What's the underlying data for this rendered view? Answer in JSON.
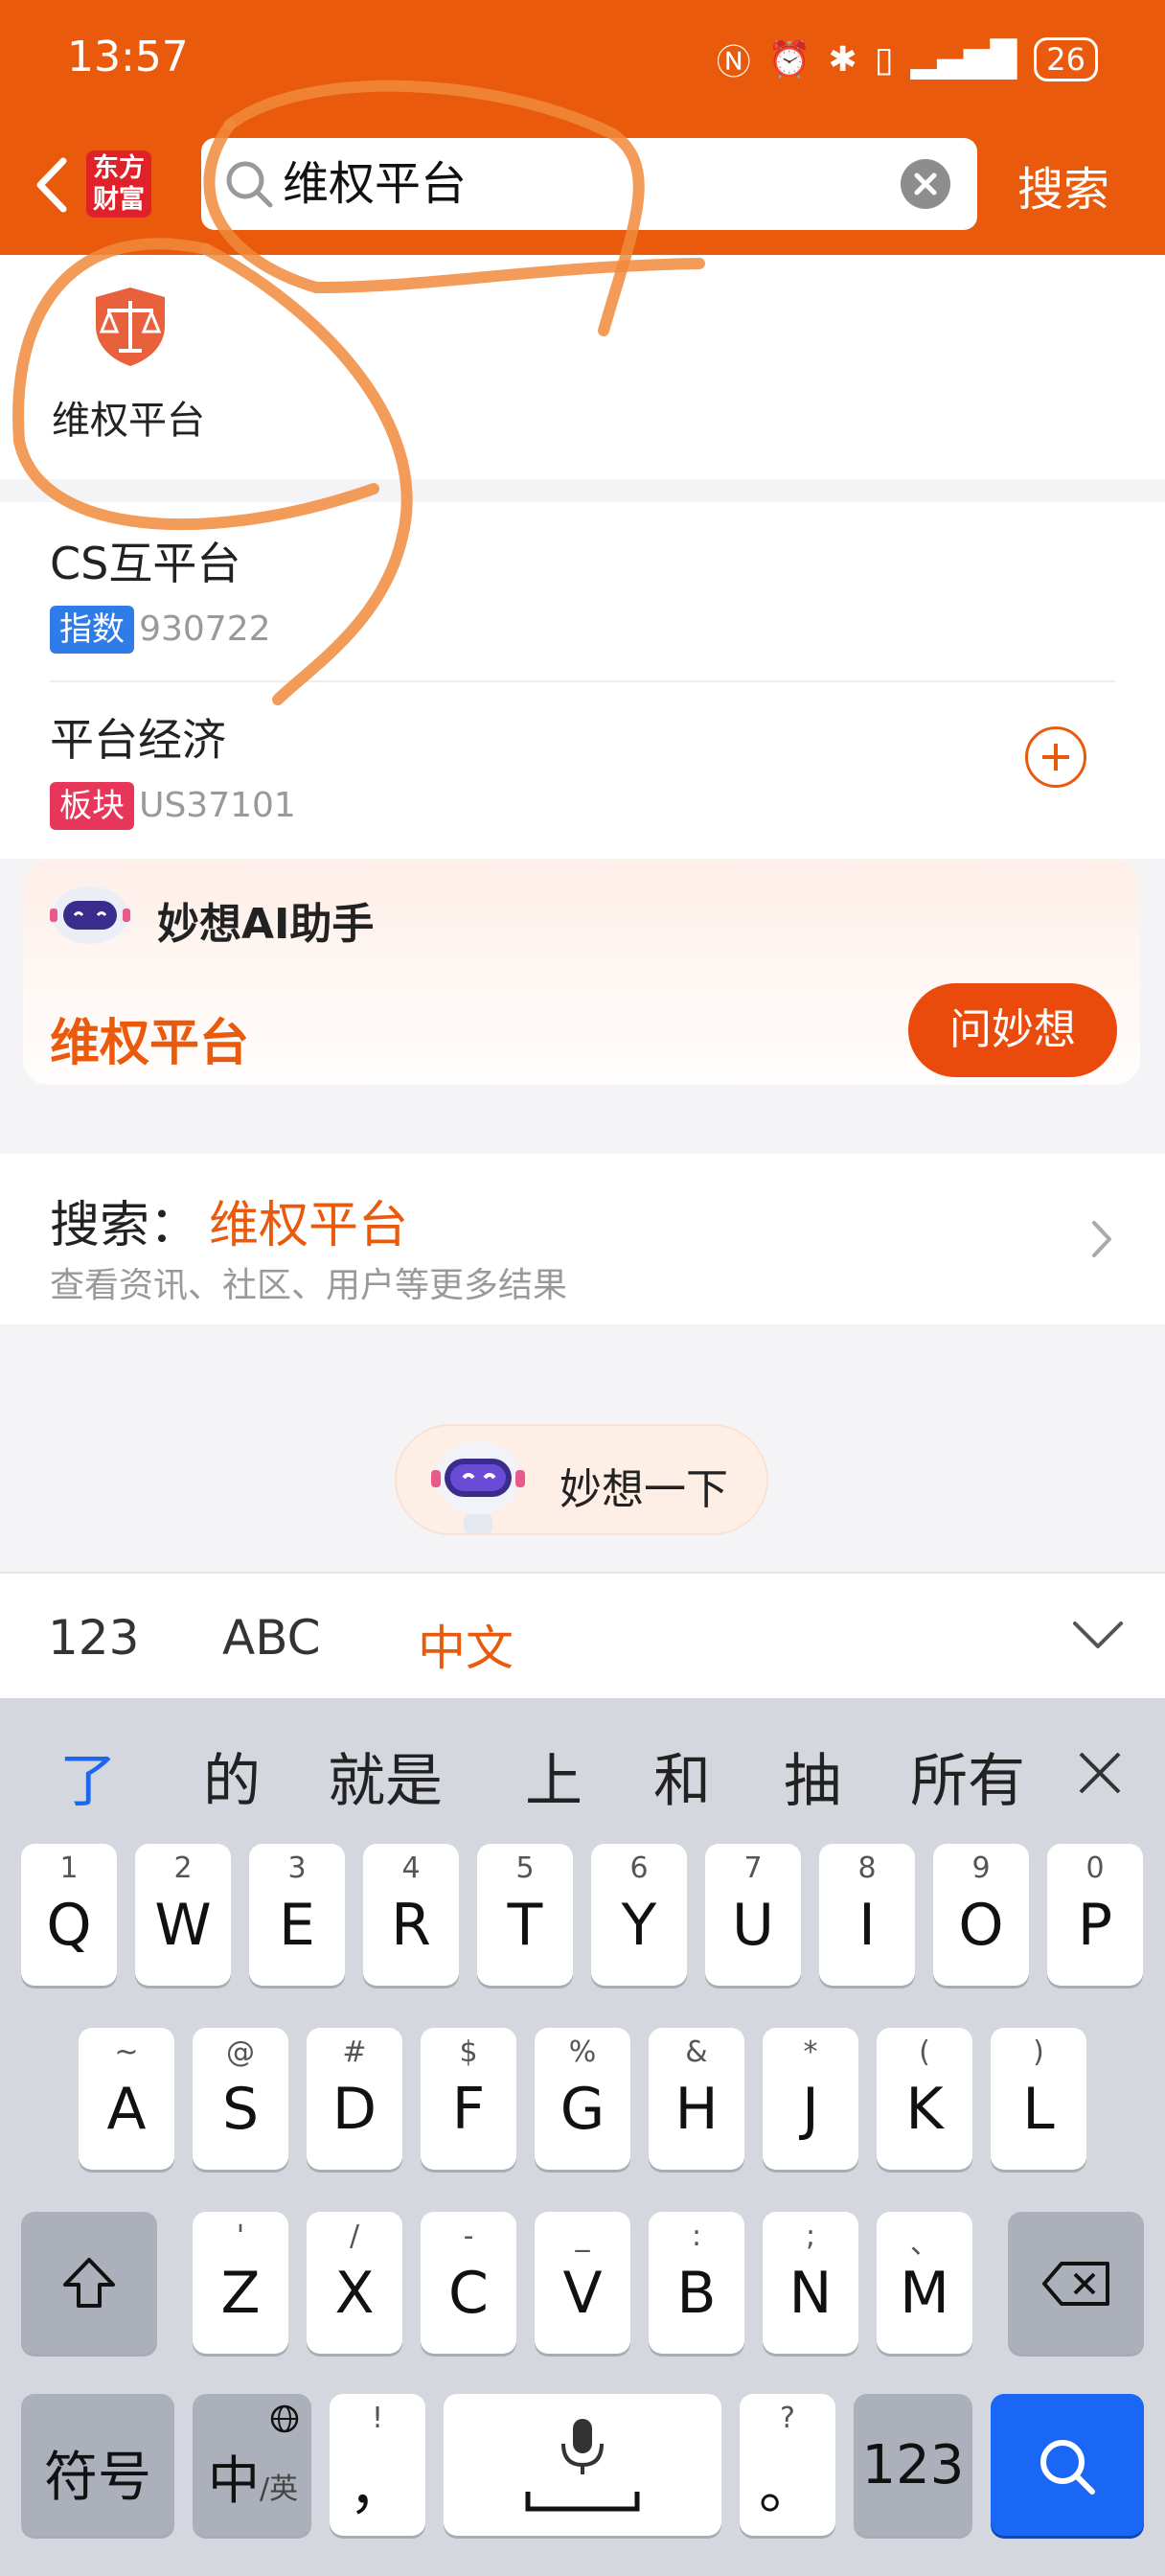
{
  "status": {
    "time": "13:57",
    "battery": "26"
  },
  "header": {
    "logo_line1": "东方",
    "logo_line2": "财富",
    "search_value": "维权平台",
    "search_button": "搜索"
  },
  "app_result": {
    "name": "维权平台"
  },
  "stocks": [
    {
      "name": "CS互平台",
      "tag": "指数",
      "tag_color": "#2f7be8",
      "code": "930722"
    },
    {
      "name": "平台经济",
      "tag": "板块",
      "tag_color": "#e8365a",
      "code": "US37101"
    }
  ],
  "ai_card": {
    "title": "妙想AI助手",
    "query": "维权平台",
    "ask_button": "问妙想"
  },
  "search_more": {
    "prefix": "搜索：",
    "query": "维权平台",
    "sub": "查看资讯、社区、用户等更多结果"
  },
  "miaoxiang": {
    "label": "妙想一下"
  },
  "keyboard_modes": {
    "num": "123",
    "abc": "ABC",
    "cn": "中文"
  },
  "candidates": [
    "了",
    "的",
    "就是",
    "上",
    "和",
    "抽",
    "所有"
  ],
  "keys_row1": [
    {
      "hint": "1",
      "main": "Q"
    },
    {
      "hint": "2",
      "main": "W"
    },
    {
      "hint": "3",
      "main": "E"
    },
    {
      "hint": "4",
      "main": "R"
    },
    {
      "hint": "5",
      "main": "T"
    },
    {
      "hint": "6",
      "main": "Y"
    },
    {
      "hint": "7",
      "main": "U"
    },
    {
      "hint": "8",
      "main": "I"
    },
    {
      "hint": "9",
      "main": "O"
    },
    {
      "hint": "0",
      "main": "P"
    }
  ],
  "keys_row2": [
    {
      "hint": "~",
      "main": "A"
    },
    {
      "hint": "@",
      "main": "S"
    },
    {
      "hint": "#",
      "main": "D"
    },
    {
      "hint": "$",
      "main": "F"
    },
    {
      "hint": "%",
      "main": "G"
    },
    {
      "hint": "&",
      "main": "H"
    },
    {
      "hint": "*",
      "main": "J"
    },
    {
      "hint": "(",
      "main": "K"
    },
    {
      "hint": ")",
      "main": "L"
    }
  ],
  "keys_row3": [
    {
      "hint": "'",
      "main": "Z"
    },
    {
      "hint": "/",
      "main": "X"
    },
    {
      "hint": "-",
      "main": "C"
    },
    {
      "hint": "_",
      "main": "V"
    },
    {
      "hint": ":",
      "main": "B"
    },
    {
      "hint": ";",
      "main": "N"
    },
    {
      "hint": "、",
      "main": "M"
    }
  ],
  "bottom_keys": {
    "symbols": "符号",
    "lang_main": "中",
    "lang_sub": "/英",
    "comma_hint": "!",
    "comma": "，",
    "period_hint": "?",
    "period": "。",
    "num": "123"
  },
  "colors": {
    "accent": "#ea5a0c",
    "keyboard_blue": "#1a66f5"
  }
}
